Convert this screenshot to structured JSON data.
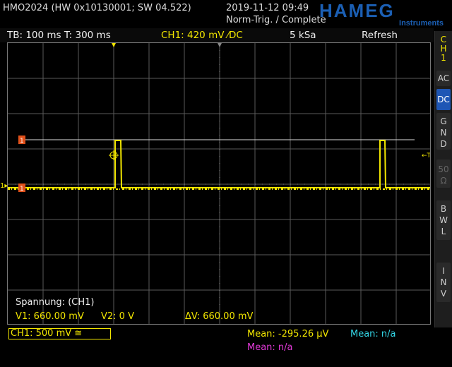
{
  "header": {
    "device": "HMO2024 (HW 0x10130001; SW 04.522)",
    "datetime": "2019-11-12 09:49",
    "status": "Norm-Trig. / Complete",
    "logo_brand": "HAMEG",
    "logo_sub": "Instruments"
  },
  "topbar": {
    "timebase": "TB: 100 ms  T: 300 ms",
    "channel": "CH1: 420 mV ⁄DC",
    "samplerate": "5 kSa",
    "mode": "Refresh"
  },
  "side_panel": {
    "channel_label": [
      "C",
      "H",
      "1"
    ],
    "buttons": [
      {
        "label": "AC",
        "active": false
      },
      {
        "label": "DC",
        "active": true
      },
      {
        "label": "G N D",
        "active": false
      },
      {
        "label": "50 Ω",
        "active": false
      },
      {
        "label": "B W L",
        "active": false
      },
      {
        "label": "I N V",
        "active": false
      }
    ]
  },
  "screen": {
    "grid_divisions": {
      "x": 12,
      "y": 8
    },
    "trigger_marker": "←T",
    "ch1_marker_label": "1",
    "cursor_markers": [
      "1",
      "1"
    ]
  },
  "measurements": {
    "title": "Spannung: (CH1)",
    "v1": "V1: 660.00 mV",
    "v2": "V2: 0 V",
    "dv": "ΔV: 660.00 mV"
  },
  "footer": {
    "ch1_scale": "CH1: 500 mV ≅",
    "mean_yellow": "Mean: -295.26 µV",
    "mean_cyan": "Mean: n/a",
    "mean_magenta": "Mean: n/a"
  },
  "colors": {
    "ch1": "#f2e600",
    "cyan": "#33d6e6",
    "magenta": "#e23ad8",
    "cursor": "#e0501a",
    "active_button": "#1e56b5"
  }
}
